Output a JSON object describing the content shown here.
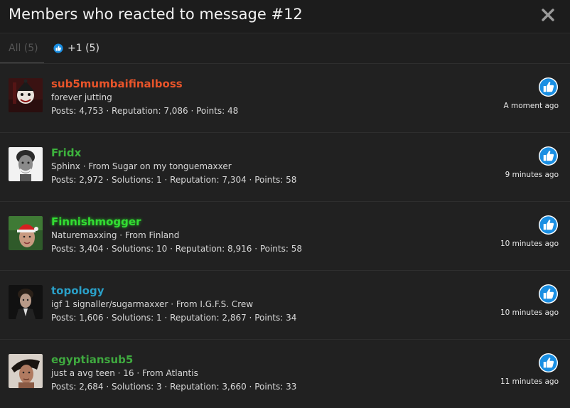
{
  "dialog": {
    "title": "Members who reacted to message #12"
  },
  "tabs": {
    "all": "All (5)",
    "like": "+1 (5)"
  },
  "colors": {
    "accent": "#1a8fe3",
    "name_orange": "#e8542a",
    "name_green": "#3db33d",
    "name_bright_green": "#33dd33",
    "name_teal": "#2aa0c8",
    "name_green2": "#3fa93f"
  },
  "members": [
    {
      "name": "sub5mumbaifinalboss",
      "title": "forever jutting",
      "stats": "Posts: 4,753 · Reputation: 7,086 · Points: 48",
      "time": "A moment ago"
    },
    {
      "name": "Fridx",
      "title": "Sphinx · From Sugar on my tonguemaxxer",
      "stats": "Posts: 2,972 · Solutions: 1 · Reputation: 7,304 · Points: 58",
      "time": "9 minutes ago"
    },
    {
      "name": "Finnishmogger",
      "title": "Naturemaxxing · From Finland",
      "stats": "Posts: 3,404 · Solutions: 10 · Reputation: 8,916 · Points: 58",
      "time": "10 minutes ago"
    },
    {
      "name": "topology",
      "title": "igf 1 signaller/sugarmaxxer · From I.G.F.S. Crew",
      "stats": "Posts: 1,606 · Solutions: 1 · Reputation: 2,867 · Points: 34",
      "time": "10 minutes ago"
    },
    {
      "name": "egyptiansub5",
      "title": "just a avg teen · 16 · From Atlantis",
      "stats": "Posts: 2,684 · Solutions: 3 · Reputation: 3,660 · Points: 33",
      "time": "11 minutes ago"
    }
  ]
}
